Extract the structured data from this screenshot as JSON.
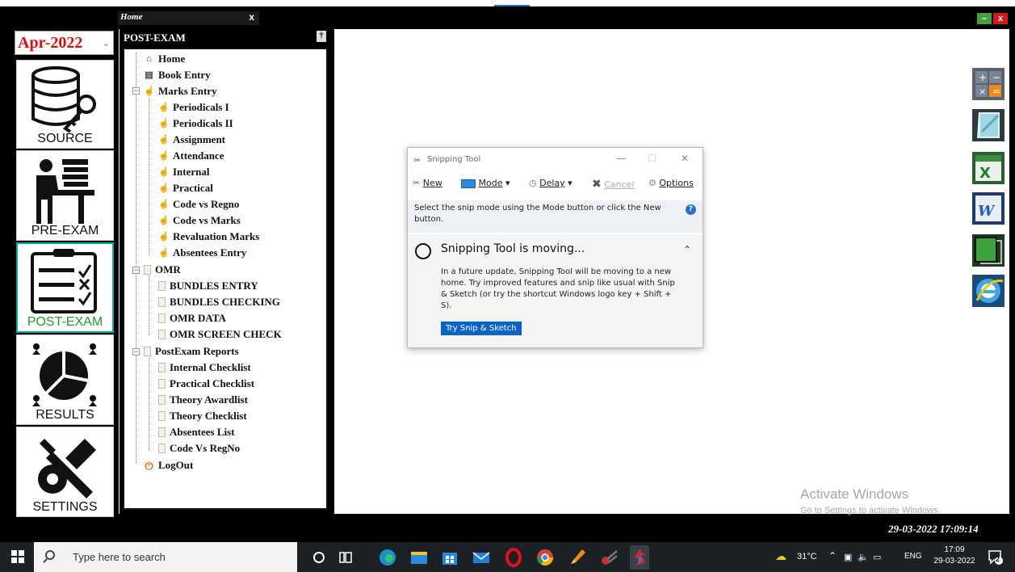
{
  "window": {
    "tab_title": "Home",
    "tab_close": "x",
    "minimize": "–",
    "close": "x"
  },
  "session": {
    "value": "Apr-2022"
  },
  "modules": [
    {
      "label": "SOURCE"
    },
    {
      "label": "PRE-EXAM"
    },
    {
      "label": "POST-EXAM",
      "active": true
    },
    {
      "label": "RESULTS"
    },
    {
      "label": "SETTINGS"
    }
  ],
  "tree": {
    "header": "POST-EXAM",
    "pin": "†",
    "items": [
      {
        "label": "Home",
        "icon": "home-icon"
      },
      {
        "label": "Book Entry",
        "icon": "book-icon"
      },
      {
        "label": "Marks Entry",
        "icon": "hand-icon"
      },
      {
        "label": "Periodicals I",
        "icon": "hand-icon"
      },
      {
        "label": "Periodicals II",
        "icon": "hand-icon"
      },
      {
        "label": "Assignment",
        "icon": "hand-icon"
      },
      {
        "label": "Attendance",
        "icon": "hand-icon"
      },
      {
        "label": "Internal",
        "icon": "hand-icon"
      },
      {
        "label": "Practical",
        "icon": "hand-icon"
      },
      {
        "label": "Code vs Regno",
        "icon": "hand-icon"
      },
      {
        "label": "Code vs Marks",
        "icon": "hand-icon"
      },
      {
        "label": "Revaluation Marks",
        "icon": "hand-icon"
      },
      {
        "label": "Absentees Entry",
        "icon": "hand-icon"
      },
      {
        "label": "OMR",
        "icon": "document-icon"
      },
      {
        "label": "BUNDLES ENTRY",
        "icon": "document-icon"
      },
      {
        "label": "BUNDLES CHECKING",
        "icon": "document-icon"
      },
      {
        "label": "OMR DATA",
        "icon": "document-icon"
      },
      {
        "label": "OMR SCREEN CHECK",
        "icon": "document-icon"
      },
      {
        "label": "PostExam Reports",
        "icon": "document-icon"
      },
      {
        "label": "Internal Checklist",
        "icon": "document-icon"
      },
      {
        "label": "Practical Checklist",
        "icon": "document-icon"
      },
      {
        "label": "Theory Awardlist",
        "icon": "document-icon"
      },
      {
        "label": "Theory Checklist",
        "icon": "document-icon"
      },
      {
        "label": "Absentees List",
        "icon": "document-icon"
      },
      {
        "label": "Code Vs RegNo",
        "icon": "document-icon"
      },
      {
        "label": "LogOut",
        "icon": "power-icon"
      }
    ]
  },
  "tools": [
    "calculator-icon",
    "notepad-icon",
    "excel-icon",
    "word-icon",
    "screen-icon",
    "internet-explorer-icon"
  ],
  "snipping_tool": {
    "title": "Snipping Tool",
    "new": "New",
    "mode": "Mode",
    "delay": "Delay",
    "cancel": "Cancel",
    "options": "Options",
    "instruction": "Select the snip mode using the Mode button or click the New button.",
    "moving_title": "Snipping Tool is moving...",
    "moving_text": "In a future update, Snipping Tool will be moving to a new home. Try improved features and snip like usual with Snip & Sketch (or try the shortcut Windows logo key + Shift + S).",
    "try_button": "Try Snip & Sketch"
  },
  "watermark": {
    "line1": "Activate Windows",
    "line2": "Go to Settings to activate Windows."
  },
  "status_clock": "29-03-2022 17:09:14",
  "taskbar": {
    "search_placeholder": "Type here to search",
    "weather": "31°C",
    "language": "ENG",
    "time": "17:09",
    "date": "29-03-2022",
    "notifications": "2"
  },
  "colors": {
    "accent_red": "#d80f0f",
    "active_green": "#1e9b2e",
    "snip_blue": "#0a64c8"
  }
}
